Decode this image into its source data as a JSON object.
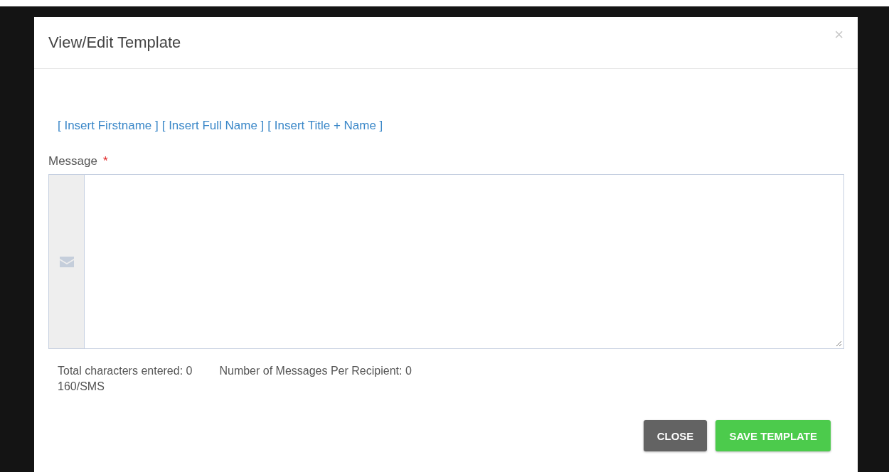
{
  "dialog": {
    "title": "View/Edit Template",
    "close_glyph": "×"
  },
  "insert_links": [
    "[ Insert Firstname ]",
    "[ Insert Full Name ]",
    "[ Insert Title + Name ]"
  ],
  "message": {
    "label": "Message",
    "required_mark": "*"
  },
  "counters": {
    "total": "Total characters entered: 0",
    "per_recipient": "Number of Messages Per Recipient:  0",
    "limit": "160/SMS"
  },
  "buttons": [
    {
      "label": "CLOSE",
      "kind": "secondary"
    },
    {
      "label": "SAVE TEMPLATE",
      "kind": "primary"
    }
  ]
}
